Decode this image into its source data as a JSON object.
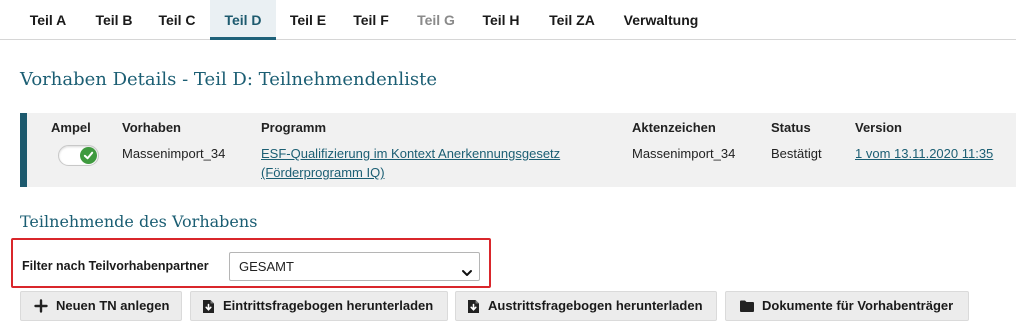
{
  "tabs": [
    {
      "label": "Teil A"
    },
    {
      "label": "Teil B"
    },
    {
      "label": "Teil C"
    },
    {
      "label": "Teil D",
      "active": true
    },
    {
      "label": "Teil E"
    },
    {
      "label": "Teil F"
    },
    {
      "label": "Teil G",
      "disabled": true
    },
    {
      "label": "Teil H"
    },
    {
      "label": "Teil ZA"
    },
    {
      "label": "Verwaltung"
    }
  ],
  "page_title": "Vorhaben Details - Teil D: Teilnehmendenliste",
  "info": {
    "headers": {
      "ampel": "Ampel",
      "vorhaben": "Vorhaben",
      "programm": "Programm",
      "aktenzeichen": "Aktenzeichen",
      "status": "Status",
      "version": "Version"
    },
    "values": {
      "ampel_state": "on",
      "vorhaben": "Massenimport_34",
      "programm_line1": "ESF-Qualifizierung im Kontext Anerkennungsgesetz",
      "programm_line2": "(Förderprogramm IQ)",
      "aktenzeichen": "Massenimport_34",
      "status": "Bestätigt",
      "version": "1 vom 13.11.2020 11:35"
    }
  },
  "section_title": "Teilnehmende des Vorhabens",
  "filter": {
    "label": "Filter nach Teilvorhabenpartner",
    "selected": "GESAMT"
  },
  "buttons": {
    "new_tn": "Neuen TN anlegen",
    "eintritt": "Eintrittsfragebogen herunterladen",
    "austritt": "Austrittsfragebogen herunterladen",
    "dokumente": "Dokumente für Vorhabenträger"
  },
  "colors": {
    "accent": "#1d5a6e",
    "highlight": "#d9262b",
    "ampel_green": "#3f9a3f"
  },
  "icons": {
    "new_tn": "plus-icon",
    "eintritt": "file-download-icon",
    "austritt": "file-download-icon",
    "dokumente": "folder-icon"
  }
}
